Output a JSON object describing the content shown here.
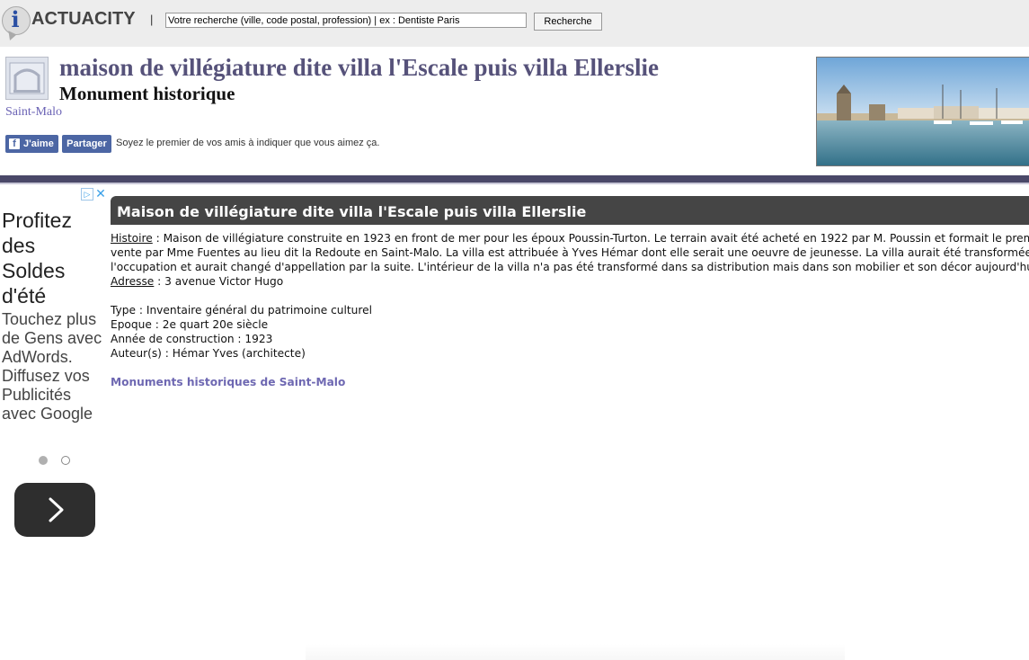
{
  "topbar": {
    "logo_i": "i",
    "logo_text": "ACTUACITY",
    "separator": "|",
    "search_value": "Votre recherche (ville, code postal, profession) | ex : Dentiste Paris",
    "search_button": "Recherche"
  },
  "header": {
    "title": "maison de villégiature dite villa l'Escale puis villa Ellerslie",
    "subtitle": "Monument historique",
    "city": "Saint-Malo",
    "fb_like": "J'aime",
    "fb_share": "Partager",
    "fb_text": "Soyez le premier de vos amis à indiquer que vous aimez ça."
  },
  "ad": {
    "info_icon": "▷",
    "close_icon": "✕",
    "headline": "Profitez des Soldes d'été",
    "body": "Touchez plus de Gens avec AdWords. Diffusez vos Publicités avec Google",
    "next_icon": "chevron-right-icon"
  },
  "article": {
    "title": "Maison de villégiature dite villa l'Escale puis villa Ellerslie",
    "histoire_label": "Histoire",
    "histoire_line1": " : Maison de villégiature construite en 1923 en front de mer pour les époux Poussin-Turton. Le terrain avait été acheté en 1922 par M. Poussin et formait le premier lot de la",
    "histoire_line2": "vente par Mme Fuentes au lieu dit la Redoute en Saint-Malo. La villa est attribuée à Yves Hémar dont elle serait une oeuvre de jeunesse. La villa aurait été transformée en hôpital pendant",
    "histoire_line3": "l'occupation et aurait changé d'appellation par la suite. L'intérieur de la villa n'a pas été transformé dans sa distribution mais dans son mobilier et son décor aujourd'hui disparus.",
    "adresse_label": "Adresse",
    "adresse_value": " : 3 avenue Victor Hugo",
    "type": "Type : Inventaire général du patrimoine culturel",
    "epoque": "Epoque : 2e quart 20e siècle",
    "annee": "Année de construction : 1923",
    "auteurs": "Auteur(s) : Hémar Yves (architecte)",
    "link": "Monuments historiques de Saint-Malo"
  }
}
